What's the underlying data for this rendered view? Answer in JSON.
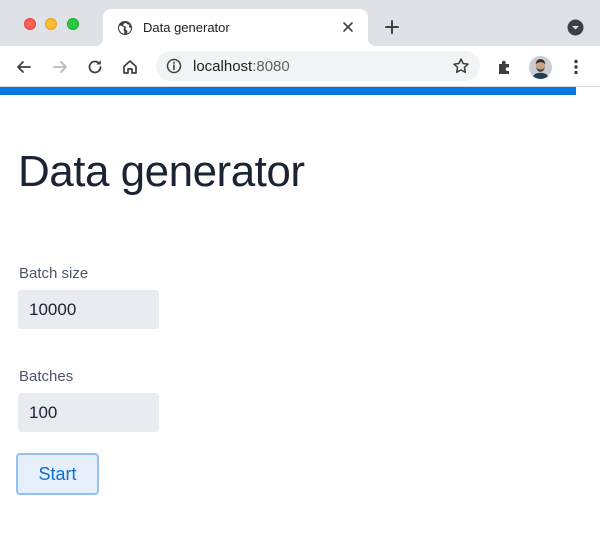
{
  "browser": {
    "tab": {
      "title": "Data generator"
    },
    "address_bar": {
      "host": "localhost",
      "port": ":8080"
    }
  },
  "page": {
    "title": "Data generator",
    "fields": [
      {
        "label": "Batch size",
        "value": "10000"
      },
      {
        "label": "Batches",
        "value": "100"
      }
    ],
    "start_button": {
      "label": "Start"
    }
  },
  "colors": {
    "accent_bar": "#0a74e0",
    "input_bg": "#e8ebef",
    "button_text": "#0d6ecd",
    "button_border": "#92c2f3"
  },
  "icons": [
    "globe-icon",
    "close-icon",
    "plus-icon",
    "chevron-down-icon",
    "back-arrow-icon",
    "forward-arrow-icon",
    "reload-icon",
    "home-icon",
    "info-icon",
    "star-icon",
    "puzzle-icon",
    "more-vertical-icon"
  ]
}
